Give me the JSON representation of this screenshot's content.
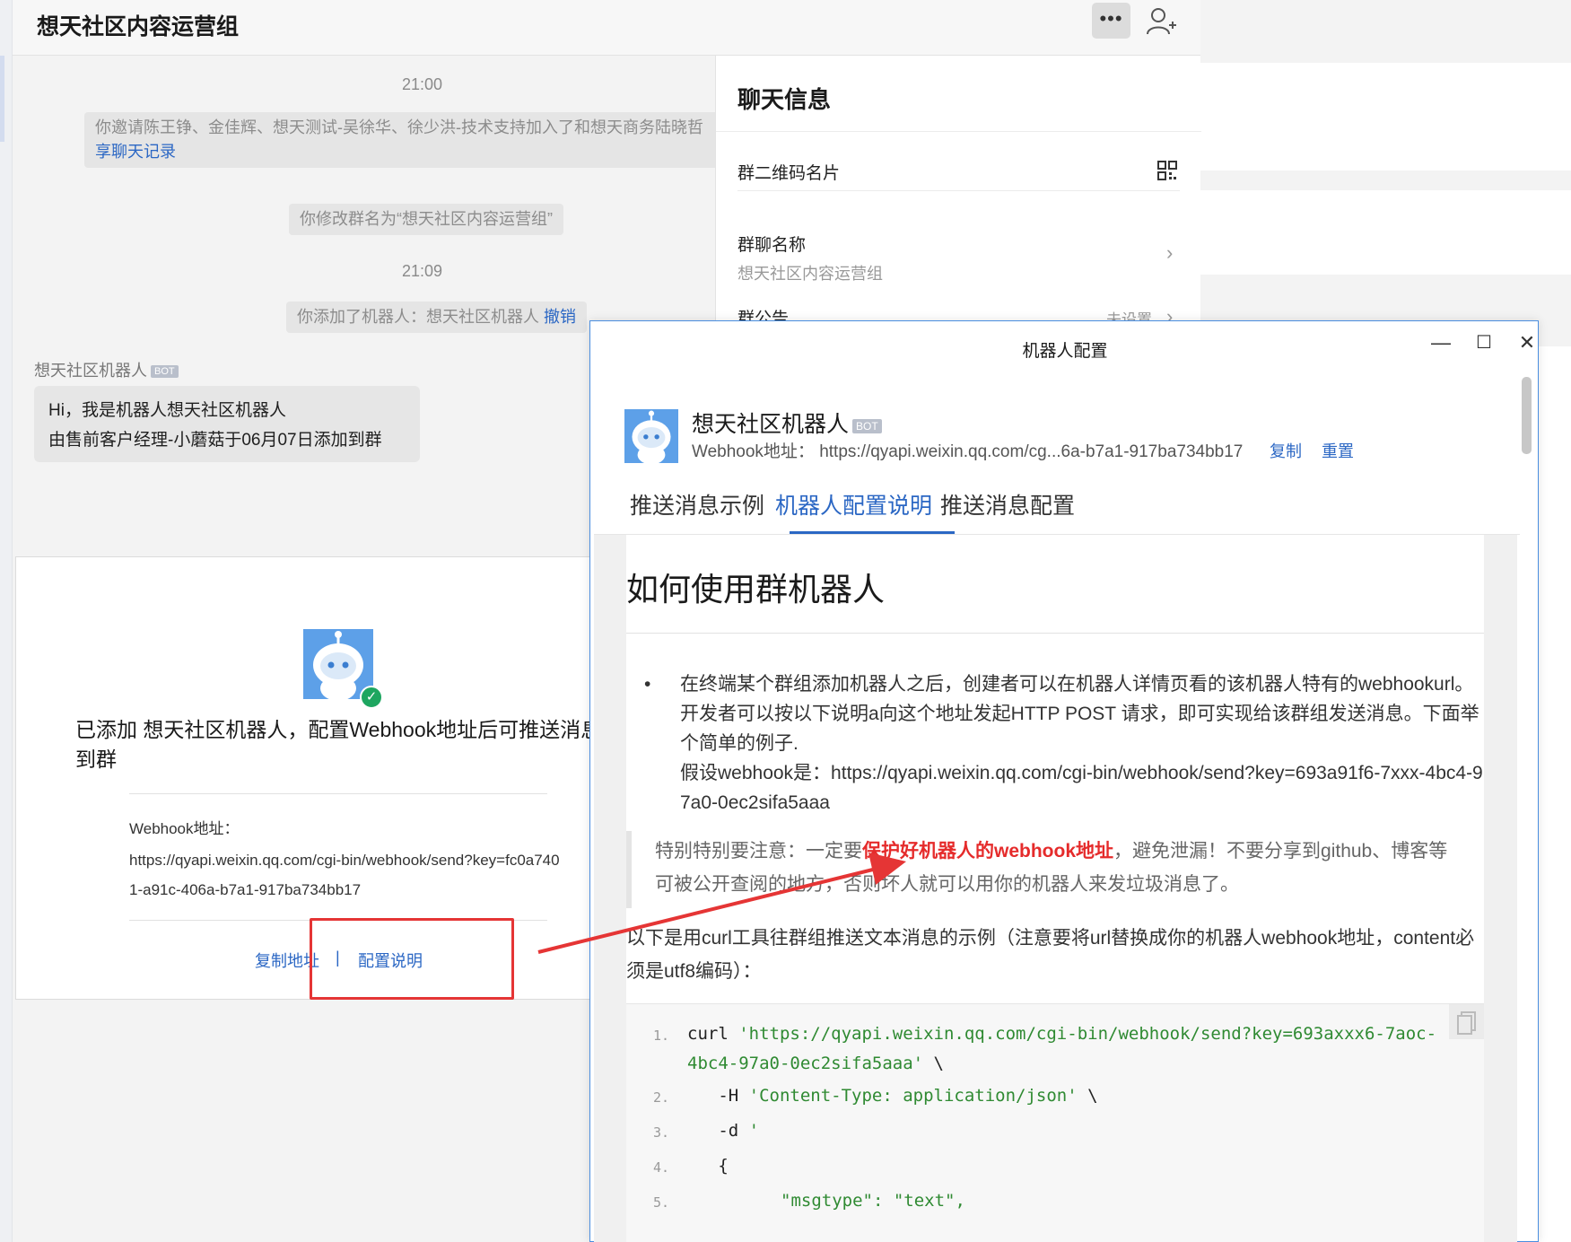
{
  "chat": {
    "group_title": "想天社区内容运营组",
    "more_icon_glyph": "•••",
    "time_1": "21:00",
    "invite_msg": "你邀请陈王铮、金佳辉、想天测试-吴徐华、徐少洪-技术支持加入了和想天商务陆晓哲",
    "invite_msg_link": "享聊天记录",
    "rename_msg": "你修改群名为“想天社区内容运营组”",
    "time_2": "21:09",
    "added_robot_msg": "你添加了机器人：想天社区机器人",
    "added_robot_link": "撤销",
    "bot_sender": "想天社区机器人",
    "bot_badge": "BOT",
    "bot_message_line1": "Hi，我是机器人想天社区机器人",
    "bot_message_line2": "由售前客户经理-小蘑菇于06月07日添加到群"
  },
  "added_card": {
    "title": "已添加 想天社区机器人，配置Webhook地址后可推送消息到群",
    "webhook_label": "Webhook地址：",
    "webhook_url": "https://qyapi.weixin.qq.com/cgi-bin/webhook/send?key=fc0a7401-a91c-406a-b7a1-917ba734bb17",
    "copy_address": "复制地址",
    "separator": "|",
    "config_help": "配置说明"
  },
  "info_panel": {
    "title": "聊天信息",
    "qr_label": "群二维码名片",
    "name_label": "群聊名称",
    "name_value": "想天社区内容运营组",
    "notice_label": "群公告",
    "notice_value": "未设置",
    "chevron": "›"
  },
  "robot_window": {
    "title": "机器人配置",
    "min": "—",
    "max": "☐",
    "close": "✕",
    "robot_name": "想天社区机器人",
    "badge": "BOT",
    "webhook_line": "Webhook地址：  https://qyapi.weixin.qq.com/cg...6a-b7a1-917ba734bb17",
    "copy": "复制",
    "reset": "重置",
    "tabs": [
      "推送消息示例",
      "机器人配置说明",
      "推送消息配置"
    ],
    "active_tab_index": 1,
    "doc": {
      "heading": "如何使用群机器人",
      "bullet_dot": "•",
      "bullet_text": "在终端某个群组添加机器人之后，创建者可以在机器人详情页看的该机器人特有的webhookurl。开发者可以按以下说明a向这个地址发起HTTP POST 请求，即可实现给该群组发送消息。下面举个简单的例子.",
      "bullet_example": "假设webhook是：https://qyapi.weixin.qq.com/cgi-bin/webhook/send?key=693a91f6-7xxx-4bc4-97a0-0ec2sifa5aaa",
      "quote_before": "特别特别要注意：一定要",
      "quote_highlight": "保护好机器人的webhook地址",
      "quote_after": "，避免泄漏！不要分享到github、博客等可被公开查阅的地方，否则坏人就可以用你的机器人来发垃圾消息了。",
      "para": "以下是用curl工具往群组推送文本消息的示例（注意要将url替换成你的机器人webhook地址，content必须是utf8编码）：",
      "code_lines": [
        {
          "n": "1.",
          "pre": "curl ",
          "str": "'https://qyapi.weixin.qq.com/cgi-bin/webhook/send?key=693axxx6-7aoc-",
          "post": ""
        },
        {
          "n": "",
          "pre": "",
          "str": "4bc4-97a0-0ec2sifa5aaa'",
          "post": " \\"
        },
        {
          "n": "2.",
          "pre": "   -H ",
          "str": "'Content-Type: application/json'",
          "post": " \\"
        },
        {
          "n": "3.",
          "pre": "   -d ",
          "str": "'",
          "post": ""
        },
        {
          "n": "4.",
          "pre": "   {",
          "str": "",
          "post": ""
        },
        {
          "n": "5.",
          "pre": "",
          "str": "\"msgtype\": \"text\",",
          "post": ""
        }
      ]
    }
  },
  "colors": {
    "accent_blue": "#2b67c4",
    "highlight_red": "#e52b2b",
    "annotation_red": "#e53535",
    "success_green": "#1ea660",
    "avatar_blue": "#5da0e8"
  }
}
